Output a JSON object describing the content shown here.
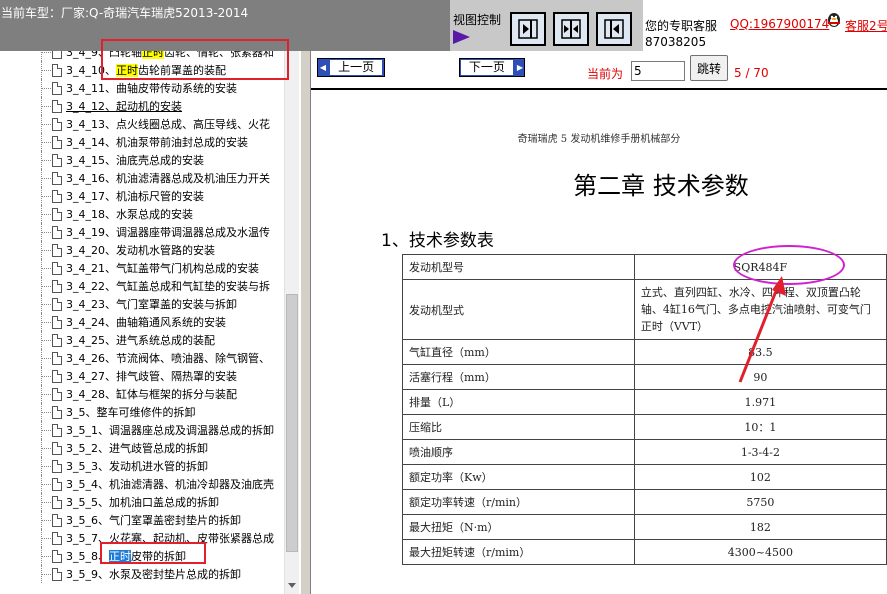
{
  "header": {
    "car_label": "当前车型：厂家:Q-奇瑞汽车瑞虎52013-2014",
    "view_control_label": "视图控制",
    "service_text": "您的专职客服",
    "service_qq": "QQ:1967900174",
    "service_alias": "客服2号",
    "service_number": "87038205"
  },
  "tree": {
    "items": [
      {
        "pre": "3_4_9、凸轮轴",
        "hl": "正时",
        "post": "齿轮、惰轮、张紧器和"
      },
      {
        "pre": "3_4_10、",
        "hl": "正时",
        "post": "齿轮前罩盖的装配"
      },
      {
        "pre": "3_4_11、曲轴皮带传动系统的安装",
        "hl": "",
        "post": ""
      },
      {
        "pre": "3_4_12、起动机的安装",
        "hl": "",
        "post": ""
      },
      {
        "pre": "3_4_13、点火线圈总成、高压导线、火花",
        "hl": "",
        "post": ""
      },
      {
        "pre": "3_4_14、机油泵带前油封总成的安装",
        "hl": "",
        "post": ""
      },
      {
        "pre": "3_4_15、油底壳总成的安装",
        "hl": "",
        "post": ""
      },
      {
        "pre": "3_4_16、机油滤清器总成及机油压力开关",
        "hl": "",
        "post": ""
      },
      {
        "pre": "3_4_17、机油标尺管的安装",
        "hl": "",
        "post": ""
      },
      {
        "pre": "3_4_18、水泵总成的安装",
        "hl": "",
        "post": ""
      },
      {
        "pre": "3_4_19、调温器座带调温器总成及水温传",
        "hl": "",
        "post": ""
      },
      {
        "pre": "3_4_20、发动机水管路的安装",
        "hl": "",
        "post": ""
      },
      {
        "pre": "3_4_21、气缸盖带气门机构总成的安装",
        "hl": "",
        "post": ""
      },
      {
        "pre": "3_4_22、气缸盖总成和气缸垫的安装与拆",
        "hl": "",
        "post": ""
      },
      {
        "pre": "3_4_23、气门室罩盖的安装与拆卸",
        "hl": "",
        "post": ""
      },
      {
        "pre": "3_4_24、曲轴箱通风系统的安装",
        "hl": "",
        "post": ""
      },
      {
        "pre": "3_4_25、进气系统总成的装配",
        "hl": "",
        "post": ""
      },
      {
        "pre": "3_4_26、节流阀体、喷油器、除气钢管、",
        "hl": "",
        "post": ""
      },
      {
        "pre": "3_4_27、排气歧管、隔热罩的安装",
        "hl": "",
        "post": ""
      },
      {
        "pre": "3_4_28、缸体与框架的拆分与装配",
        "hl": "",
        "post": ""
      },
      {
        "pre": "3_5、整车可维修件的拆卸",
        "hl": "",
        "post": ""
      },
      {
        "pre": "3_5_1、调温器座总成及调温器总成的拆卸",
        "hl": "",
        "post": ""
      },
      {
        "pre": "3_5_2、进气歧管总成的拆卸",
        "hl": "",
        "post": ""
      },
      {
        "pre": "3_5_3、发动机进水管的拆卸",
        "hl": "",
        "post": ""
      },
      {
        "pre": "3_5_4、机油滤清器、机油冷却器及油底壳",
        "hl": "",
        "post": ""
      },
      {
        "pre": "3_5_5、加机油口盖总成的拆卸",
        "hl": "",
        "post": ""
      },
      {
        "pre": "3_5_6、气门室罩盖密封垫片的拆卸",
        "hl": "",
        "post": ""
      },
      {
        "pre": "3_5_7、火花塞、起动机、皮带张紧器总成",
        "hl": "",
        "post": ""
      },
      {
        "pre": "3_5_8、",
        "hl": "正时",
        "post": "皮带的拆卸"
      },
      {
        "pre": "3_5_9、水泵及密封垫片总成的拆卸",
        "hl": "",
        "post": ""
      }
    ]
  },
  "nav": {
    "prev_label": "上一页",
    "next_label": "下一页",
    "current_label": "当前为",
    "page_value": "5",
    "jump_label": "跳转",
    "page_count": "5 / 70"
  },
  "document": {
    "header": "奇瑞瑞虎 5 发动机维修手册机械部分",
    "chapter": "第二章  技术参数",
    "section": "1、技术参数表",
    "table": [
      {
        "k": "发动机型号",
        "v": "SQR484F"
      },
      {
        "k": "发动机型式",
        "v": "立式、直列四缸、水冷、四冲程、双顶置凸轮轴、4缸16气门、多点电控汽油喷射、可变气门正时（VVT）"
      },
      {
        "k": "气缸直径（mm）",
        "v": "83.5"
      },
      {
        "k": "活塞行程（mm）",
        "v": "90"
      },
      {
        "k": "排量（L）",
        "v": "1.971"
      },
      {
        "k": "压缩比",
        "v": "10：1"
      },
      {
        "k": "喷油顺序",
        "v": "1-3-4-2"
      },
      {
        "k": "额定功率（Kw）",
        "v": "102"
      },
      {
        "k": "额定功率转速（r/min）",
        "v": "5750"
      },
      {
        "k": "最大扭矩（N·m）",
        "v": "182"
      },
      {
        "k": "最大扭矩转速（r/mim）",
        "v": "4300~4500"
      }
    ]
  },
  "colors": {
    "highlight_yellow": "#ffff00",
    "highlight_blue": "#1f7bd8",
    "annotation_red": "#e0202c",
    "annotation_magenta": "#d020d0",
    "nav_button_blue": "#2f4fb8"
  }
}
